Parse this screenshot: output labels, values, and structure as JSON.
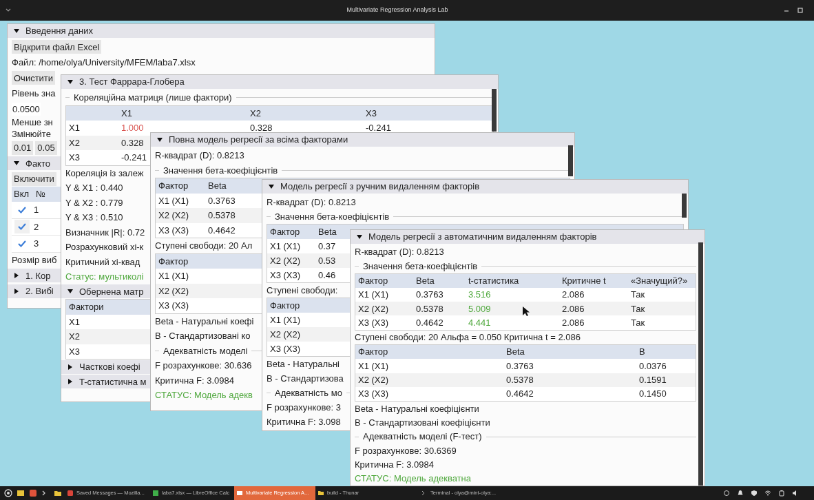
{
  "titlebar": {
    "title": "Multivariate Regression Analysis Lab"
  },
  "windows": [
    {
      "title": "Введення даних",
      "expanded": true,
      "items": [
        {
          "kind": "button",
          "text": "Відкрити файл Excel"
        },
        {
          "kind": "text",
          "text": "Файл: /home/olya/University/MFEM/laba7.xlsx"
        },
        {
          "kind": "button",
          "text": "Очистити"
        },
        {
          "kind": "text",
          "text": "Рівень зна"
        },
        {
          "kind": "field",
          "text": "0.0500"
        },
        {
          "kind": "tight",
          "text": "Менше зн"
        },
        {
          "kind": "tight",
          "text": "Змінюйте"
        },
        {
          "kind": "buttons",
          "labels": [
            "0.01",
            "0.05"
          ]
        },
        {
          "kind": "section",
          "text": "Факто",
          "expanded": true
        },
        {
          "kind": "button",
          "text": "Включити"
        },
        {
          "kind": "checktable",
          "columns": [
            "Вкл",
            "№"
          ],
          "rows": [
            {
              "checked": true,
              "number": "1"
            },
            {
              "checked": true,
              "number": "2"
            },
            {
              "checked": true,
              "number": "3"
            }
          ]
        },
        {
          "kind": "text",
          "text": "Розмір виб"
        },
        {
          "kind": "section",
          "text": "1. Кор",
          "expanded": false
        },
        {
          "kind": "section",
          "text": "2. Вибі",
          "expanded": false
        }
      ]
    },
    {
      "title": "3. Тест Фаррара-Глобера",
      "expanded": true,
      "items": [
        {
          "kind": "group",
          "text": "Кореляційна матриця (лише фактори)"
        },
        {
          "kind": "table",
          "columns": [
            "",
            "X1",
            "X2",
            "X3"
          ],
          "rows": [
            [
              "X1",
              {
                "text": "1.000",
                "color": "#d9534f"
              },
              "0.328",
              "-0.241"
            ],
            [
              "X2",
              "0.328"
            ],
            [
              "X3",
              "-0.241"
            ]
          ]
        },
        {
          "kind": "text",
          "text": "Кореляція із залеж"
        },
        {
          "kind": "text",
          "text": "Y & X1 : 0.440"
        },
        {
          "kind": "text",
          "text": "Y & X2 : 0.779"
        },
        {
          "kind": "text",
          "text": "Y & X3 : 0.510"
        },
        {
          "kind": "text",
          "text": "Визначник |R|: 0.72"
        },
        {
          "kind": "text",
          "text": "Розрахунковий хі-к"
        },
        {
          "kind": "text",
          "text": "Критичний хі-квад"
        },
        {
          "kind": "text",
          "text": "Статус: мультиколі",
          "color": "#4fa83d"
        },
        {
          "kind": "section",
          "text": "Обернена матр",
          "expanded": true
        },
        {
          "kind": "table",
          "columns": [
            "Фактори"
          ],
          "rows": [
            [
              "X1"
            ],
            [
              "X2"
            ],
            [
              "X3"
            ]
          ]
        },
        {
          "kind": "section",
          "text": "Часткові коефі",
          "expanded": false
        },
        {
          "kind": "section",
          "text": "T-статистична м",
          "expanded": false
        }
      ]
    },
    {
      "title": "Повна модель регресії за всіма факторами",
      "expanded": true,
      "items": [
        {
          "kind": "text",
          "text": "R-квадрат (D): 0.8213"
        },
        {
          "kind": "group",
          "text": "Значення бета-коефіцієнтів"
        },
        {
          "kind": "table",
          "columns": [
            "Фактор",
            "Beta"
          ],
          "rows": [
            [
              "X1 (X1)",
              "0.3763"
            ],
            [
              "X2 (X2)",
              "0.5378"
            ],
            [
              "X3 (X3)",
              "0.4642"
            ]
          ]
        },
        {
          "kind": "text",
          "text": "Ступені свободи: 20 Ал"
        },
        {
          "kind": "table",
          "columns": [
            "Фактор"
          ],
          "rows": [
            [
              "X1 (X1)"
            ],
            [
              "X2 (X2)"
            ],
            [
              "X3 (X3)"
            ]
          ]
        },
        {
          "kind": "text",
          "text": "Beta - Натуральні коефі"
        },
        {
          "kind": "text",
          "text": "B - Стандартизовані ко"
        },
        {
          "kind": "group",
          "text": "Адекватність моделі"
        },
        {
          "kind": "text",
          "text": "F розрахункове: 30.636"
        },
        {
          "kind": "text",
          "text": "Критична F: 3.0984"
        },
        {
          "kind": "text",
          "text": "СТАТУС: Модель адекв",
          "color": "#4fa83d"
        }
      ]
    },
    {
      "title": "Модель регресії з ручним видаленням факторів",
      "expanded": true,
      "items": [
        {
          "kind": "text",
          "text": "R-квадрат (D): 0.8213"
        },
        {
          "kind": "group",
          "text": "Значення бета-коефіцієнтів"
        },
        {
          "kind": "table",
          "columns": [
            "Фактор",
            "Beta"
          ],
          "rows": [
            [
              "X1 (X1)",
              "0.37"
            ],
            [
              "X2 (X2)",
              "0.53"
            ],
            [
              "X3 (X3)",
              "0.46"
            ]
          ]
        },
        {
          "kind": "text",
          "text": "Ступені свободи:"
        },
        {
          "kind": "table",
          "columns": [
            "Фактор"
          ],
          "rows": [
            [
              "X1 (X1)"
            ],
            [
              "X2 (X2)"
            ],
            [
              "X3 (X3)"
            ]
          ]
        },
        {
          "kind": "text",
          "text": "Beta - Натуральні"
        },
        {
          "kind": "text",
          "text": "B - Стандартизова"
        },
        {
          "kind": "group",
          "text": "Адекватність мо"
        },
        {
          "kind": "text",
          "text": "F розрахункове: 3"
        },
        {
          "kind": "text",
          "text": "Критична F: 3.098"
        }
      ]
    },
    {
      "title": "Модель регресії з автоматичним видаленням факторів",
      "expanded": true,
      "items": [
        {
          "kind": "text",
          "text": "R-квадрат (D): 0.8213"
        },
        {
          "kind": "group",
          "text": "Значення бета-коефіцієнтів"
        },
        {
          "kind": "table",
          "columns": [
            "Фактор",
            "Beta",
            "t-статистика",
            "Критичне t",
            "«Значущий?»"
          ],
          "rows": [
            [
              "X1 (X1)",
              "0.3763",
              {
                "text": "3.516",
                "color": "#4fa83d"
              },
              "2.086",
              "Так"
            ],
            [
              "X2 (X2)",
              "0.5378",
              {
                "text": "5.009",
                "color": "#4fa83d"
              },
              "2.086",
              "Так"
            ],
            [
              "X3 (X3)",
              "0.4642",
              {
                "text": "4.441",
                "color": "#4fa83d"
              },
              "2.086",
              "Так"
            ]
          ]
        },
        {
          "kind": "text",
          "text": "Ступені свободи: 20 Альфа = 0.050 Критична t = 2.086"
        },
        {
          "kind": "table",
          "columns": [
            "Фактор",
            "Beta",
            "B"
          ],
          "rows": [
            [
              "X1 (X1)",
              "0.3763",
              "0.0376"
            ],
            [
              "X2 (X2)",
              "0.5378",
              "0.1591"
            ],
            [
              "X3 (X3)",
              "0.4642",
              "0.1450"
            ]
          ]
        },
        {
          "kind": "text",
          "text": "Beta - Натуральні коефіцієнти"
        },
        {
          "kind": "text",
          "text": "B - Стандартизовані коефіцієнти"
        },
        {
          "kind": "group",
          "text": "Адекватність моделі (F-тест)"
        },
        {
          "kind": "text",
          "text": "F розрахункове: 30.6369"
        },
        {
          "kind": "text",
          "text": "Критична F: 3.0984"
        },
        {
          "kind": "text",
          "text": "СТАТУС: Модель адекватна",
          "color": "#4fa83d"
        }
      ]
    }
  ],
  "taskbar": {
    "tasks": [
      {
        "label": "Saved Messages — Mozilla...",
        "selected": false
      },
      {
        "label": "laba7.xlsx — LibreOffice Calc",
        "selected": false
      },
      {
        "label": "Multivariate Regression A...",
        "selected": true
      },
      {
        "label": "build - Thunar",
        "selected": false
      },
      {
        "label": "Terminal - olya@mint-olya:...",
        "selected": false
      }
    ]
  }
}
